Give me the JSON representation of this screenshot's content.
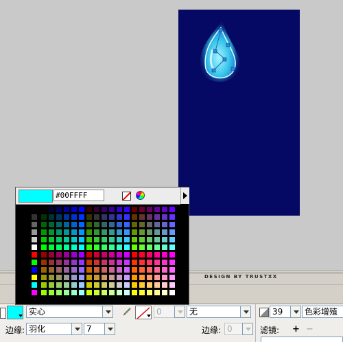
{
  "canvas": {
    "credit": "DESIGN BY TRUSTXX",
    "background": "#060963"
  },
  "swatch": {
    "selected_hex": "#00FFFF",
    "preview_color": "#00FFFF",
    "left_column": [
      "#000000",
      "#333333",
      "#666666",
      "#999999",
      "#cccccc",
      "#ffffff",
      "#ff0000",
      "#00ff00",
      "#0000ff",
      "#ffff00",
      "#00ffff",
      "#ff00ff"
    ]
  },
  "props": {
    "fill_style": "实心",
    "edge_label": "边缘:",
    "edge_value": "羽化",
    "edge_size": "7",
    "stroke_size": "0",
    "stroke_style": "无",
    "stroke_edge_label": "边缘:",
    "stroke_edge_size": "0",
    "blend_value": "39",
    "blend_mode": "色彩增殖",
    "filter_label": "滤镜:",
    "fill_color": "#00ffff",
    "stroke_color": "#ff0000"
  }
}
